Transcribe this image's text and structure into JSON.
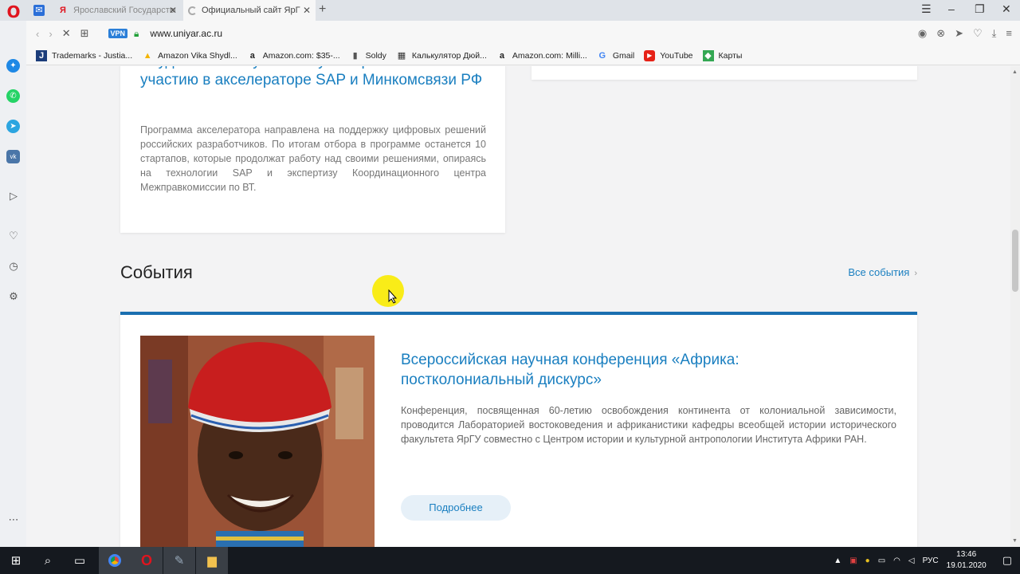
{
  "browser": {
    "tabs": [
      {
        "label": "Ярославский Государственный"
      },
      {
        "label": "Официальный сайт ЯрГУ"
      }
    ],
    "url": "www.uniyar.ac.ru",
    "vpn_label": "VPN",
    "bookmarks": [
      {
        "label": "Trademarks - Justia..."
      },
      {
        "label": "Amazon Vika Shydl..."
      },
      {
        "label": "Amazon.com: $35-..."
      },
      {
        "label": "Soldy"
      },
      {
        "label": "Калькулятор Дюй..."
      },
      {
        "label": "Amazon.com: Milli..."
      },
      {
        "label": "Gmail"
      },
      {
        "label": "YouTube"
      },
      {
        "label": "Карты"
      }
    ]
  },
  "news_card": {
    "title": "Студенты и выпускники вузов приглашаются к участию в акселераторе SAP и Минкомсвязи РФ",
    "description": "Программа акселератора направлена на поддержку цифровых решений российских разработчиков. По итогам отбора в программе останется 10 стартапов, которые продолжат работу над своими решениями, опираясь на технологии SAP и экспертизу Координационного центра Межправкомиссии по ВТ."
  },
  "events": {
    "section_title": "События",
    "all_events_label": "Все события",
    "featured": {
      "title": "Всероссийская научная конференция «Африка: постколониальный дискурс»",
      "description": "Конференция, посвященная 60-летию освобождения континента от колониальной зависимости, проводится Лабораторией востоковедения и африканистики кафедры всеобщей истории исторического факультета ЯрГУ совместно с Центром истории и культурной антропологии Института Африки РАН.",
      "more_label": "Подробнее"
    }
  },
  "taskbar": {
    "language": "РУС",
    "time": "13:46",
    "date": "19.01.2020"
  },
  "colors": {
    "accent": "#1a7fc0",
    "event_border": "#1a6fb0"
  }
}
